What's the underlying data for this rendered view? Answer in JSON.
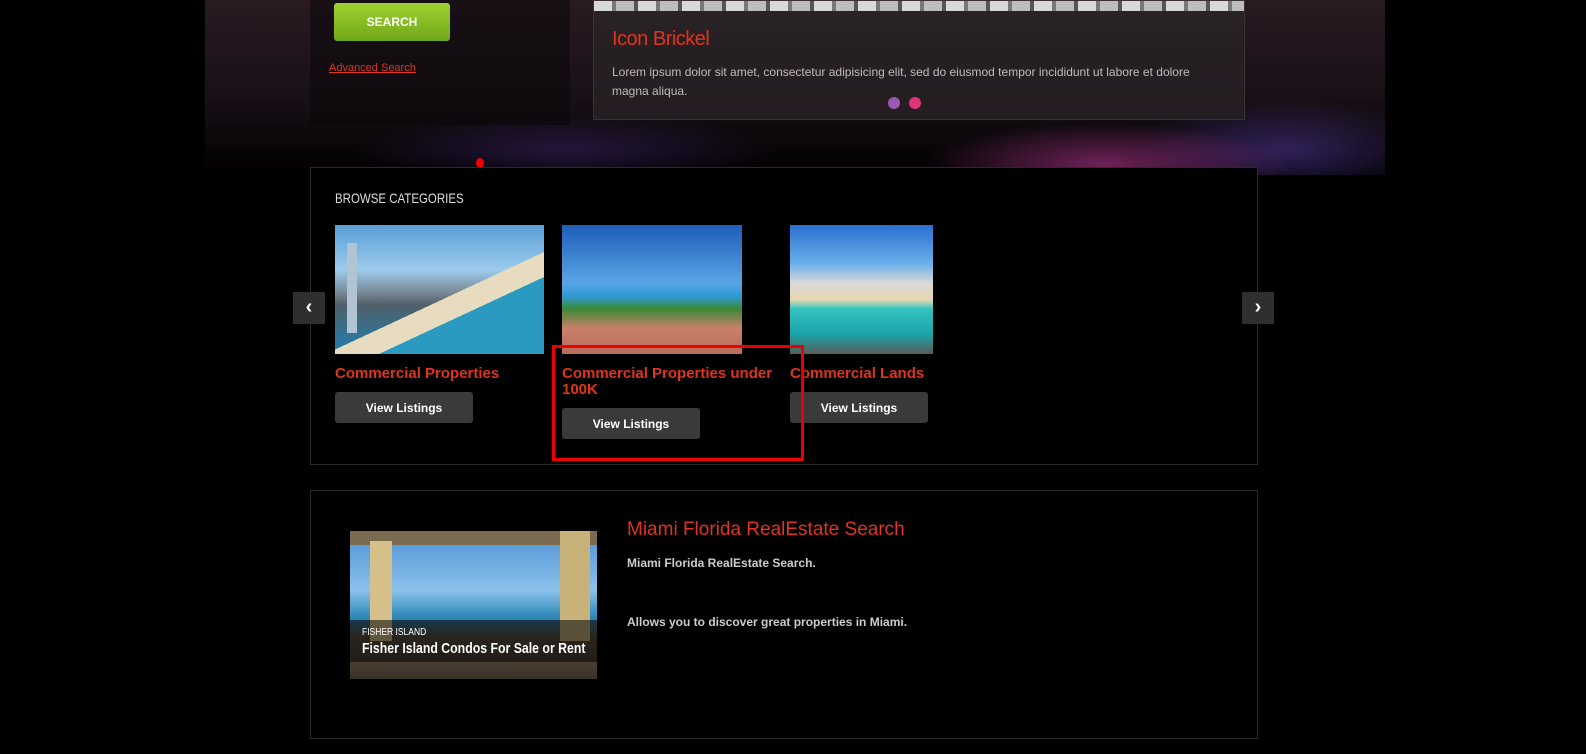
{
  "search": {
    "button_label": "SEARCH",
    "advanced_link": "Advanced Search"
  },
  "slider": {
    "title": "Icon Brickel",
    "text": "Lorem ipsum dolor sit amet, consectetur adipisicing elit, sed do eiusmod tempor incididunt ut labore et dolore magna aliqua.",
    "dots": [
      {
        "color": "#9b59b6",
        "active": false
      },
      {
        "color": "#e0347a",
        "active": true
      }
    ]
  },
  "browse": {
    "title": "BROWSE CATEGORIES",
    "prev_arrow": "‹",
    "next_arrow": "›",
    "categories": [
      {
        "title": "Commercial Properties",
        "button": "View Listings"
      },
      {
        "title": "Commercial Properties under 100K",
        "button": "View Listings"
      },
      {
        "title": "Commercial Lands",
        "button": "View Listings"
      }
    ]
  },
  "featured": {
    "image_small": "FISHER ISLAND",
    "image_big": "Fisher Island Condos For Sale or Rent",
    "title": "Miami Florida RealEstate Search",
    "p1": "Miami Florida RealEstate Search.",
    "p2": "Allows you to discover great properties in Miami."
  },
  "colors": {
    "accent": "#e0341c",
    "search_green": "#8cc426",
    "highlight": "#ee0000"
  }
}
